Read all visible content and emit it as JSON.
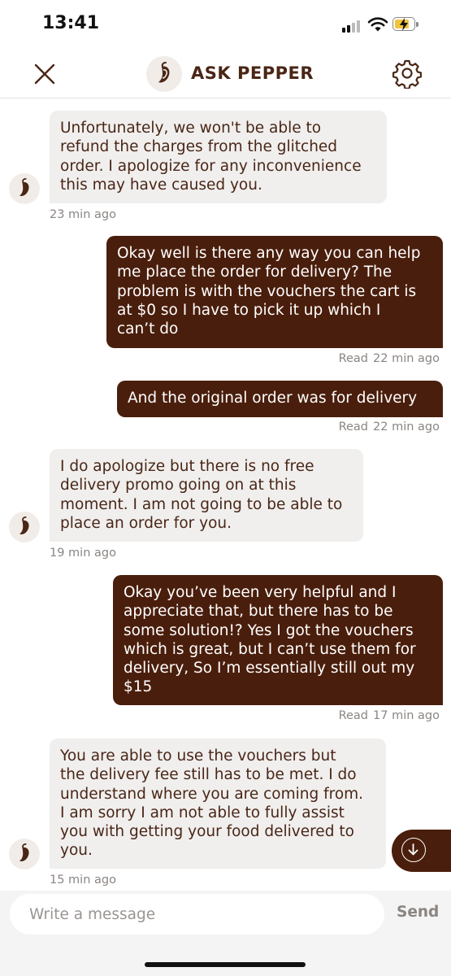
{
  "status_bar": {
    "time": "13:41"
  },
  "header": {
    "title": "ASK PEPPER",
    "close_icon": "close-x-icon",
    "settings_icon": "gear-icon",
    "logo_icon": "chili-pepper-icon"
  },
  "messages": [
    {
      "sender": "agent",
      "text": "Unfortunately, we won't be able to\nrefund the charges from the glitched\norder. I apologize for any inconvenience\nthis may have caused you.",
      "time": "23 min ago"
    },
    {
      "sender": "user",
      "text": "Okay well is there any way you can help\nme place the order for delivery? The\nproblem is with the vouchers the cart is\nat $0 so I have to pick it up which I\ncan’t do",
      "read": "Read",
      "time": "22 min ago"
    },
    {
      "sender": "user",
      "text": "And the original order was for delivery",
      "read": "Read",
      "time": "22 min ago"
    },
    {
      "sender": "agent",
      "text": "I do apologize but there is no free\ndelivery promo going on at this\nmoment. I am not going to be able to\nplace an order for you.",
      "time": "19 min ago"
    },
    {
      "sender": "user",
      "text": "Okay you’ve been very helpful and I\nappreciate that, but there has to be\nsome solution!?  Yes I got the vouchers\nwhich is great, but I can’t use them for\ndelivery, So I’m essentially still out my\n$15",
      "read": "Read",
      "time": "17 min ago"
    },
    {
      "sender": "agent",
      "text": "You are able to use the vouchers but\nthe delivery fee still has to be met. I do\nunderstand where you are coming from.\nI am sorry I am not able to fully assist\nyou with getting your food delivered to\nyou.",
      "time": "15 min ago"
    }
  ],
  "composer": {
    "placeholder": "Write a message",
    "send_label": "Send"
  },
  "scroll_down_icon": "arrow-down-circle-icon",
  "colors": {
    "brand_brown": "#4a1e0c",
    "agent_bubble": "#f0efee",
    "meta_gray": "#8a8582",
    "composer_bg": "#f4f4f4"
  }
}
